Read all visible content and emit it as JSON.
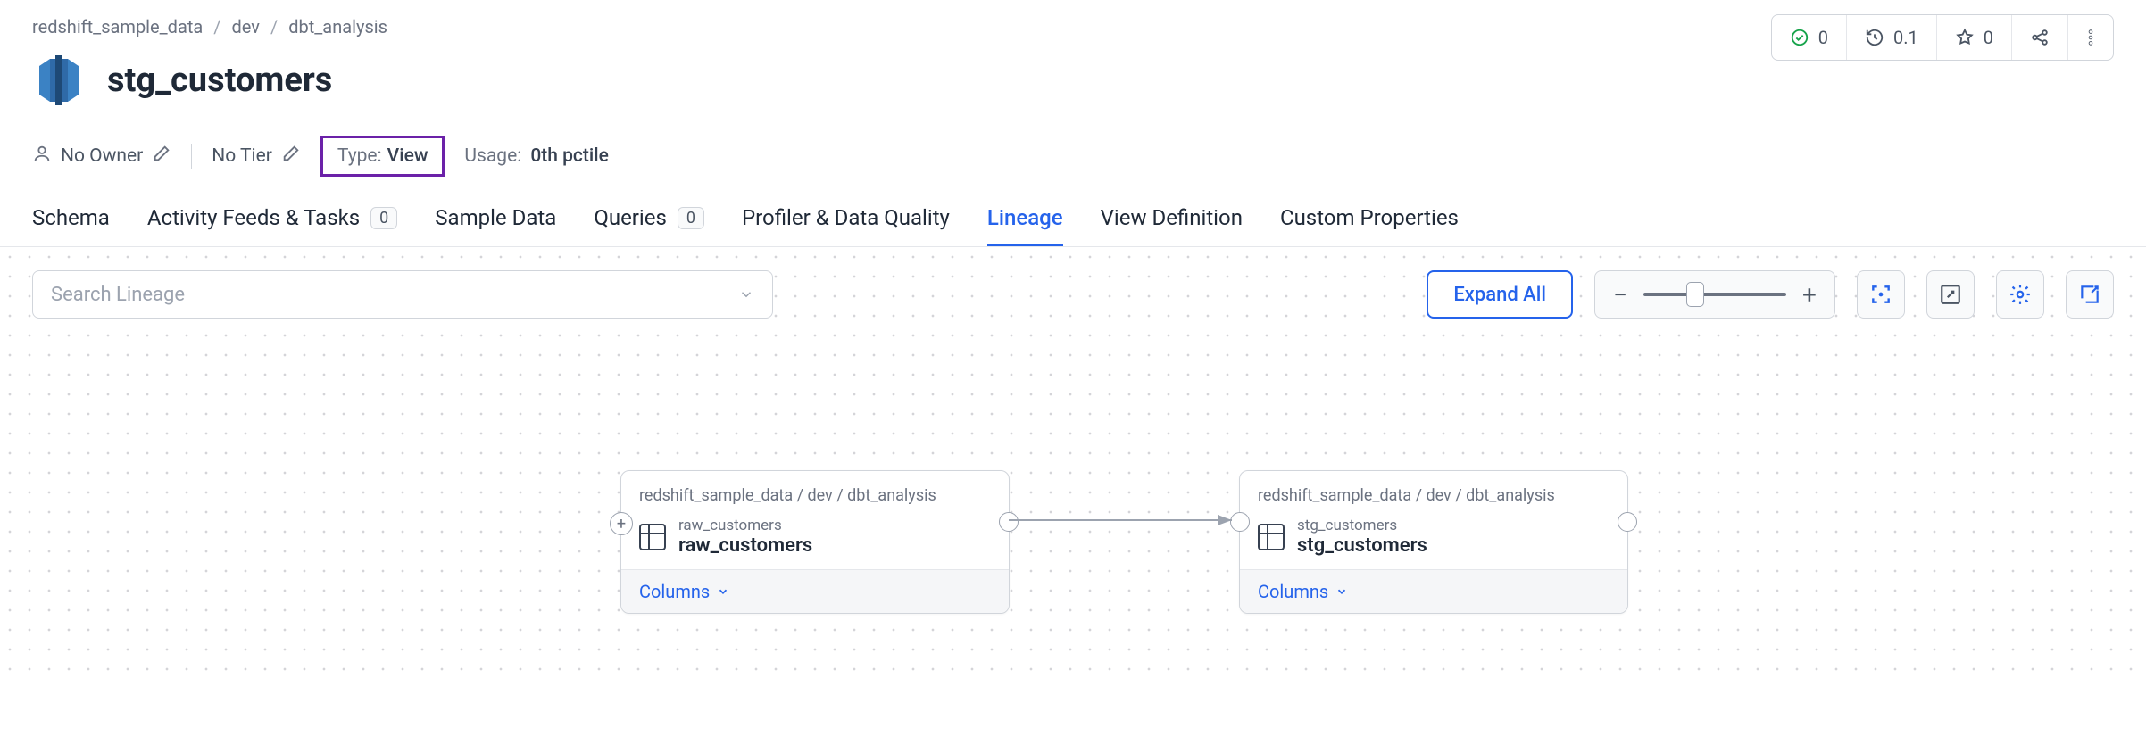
{
  "breadcrumb": [
    "redshift_sample_data",
    "dev",
    "dbt_analysis"
  ],
  "entity": {
    "name": "stg_customers",
    "owner_label": "No Owner",
    "tier_label": "No Tier",
    "type_label": "Type:",
    "type_value": "View",
    "usage_label": "Usage:",
    "usage_value": "0th pctile"
  },
  "stats": {
    "success": "0",
    "time": "0.1",
    "star": "0"
  },
  "tabs": {
    "schema": "Schema",
    "activity": "Activity Feeds & Tasks",
    "activity_badge": "0",
    "sample": "Sample Data",
    "queries": "Queries",
    "queries_badge": "0",
    "profiler": "Profiler & Data Quality",
    "lineage": "Lineage",
    "viewdef": "View Definition",
    "custom": "Custom Properties"
  },
  "toolbar": {
    "search_placeholder": "Search Lineage",
    "expand_all": "Expand All"
  },
  "nodes": {
    "raw": {
      "path": "redshift_sample_data / dev / dbt_analysis",
      "small": "raw_customers",
      "big": "raw_customers",
      "columns": "Columns"
    },
    "stg": {
      "path": "redshift_sample_data / dev / dbt_analysis",
      "small": "stg_customers",
      "big": "stg_customers",
      "columns": "Columns"
    }
  }
}
